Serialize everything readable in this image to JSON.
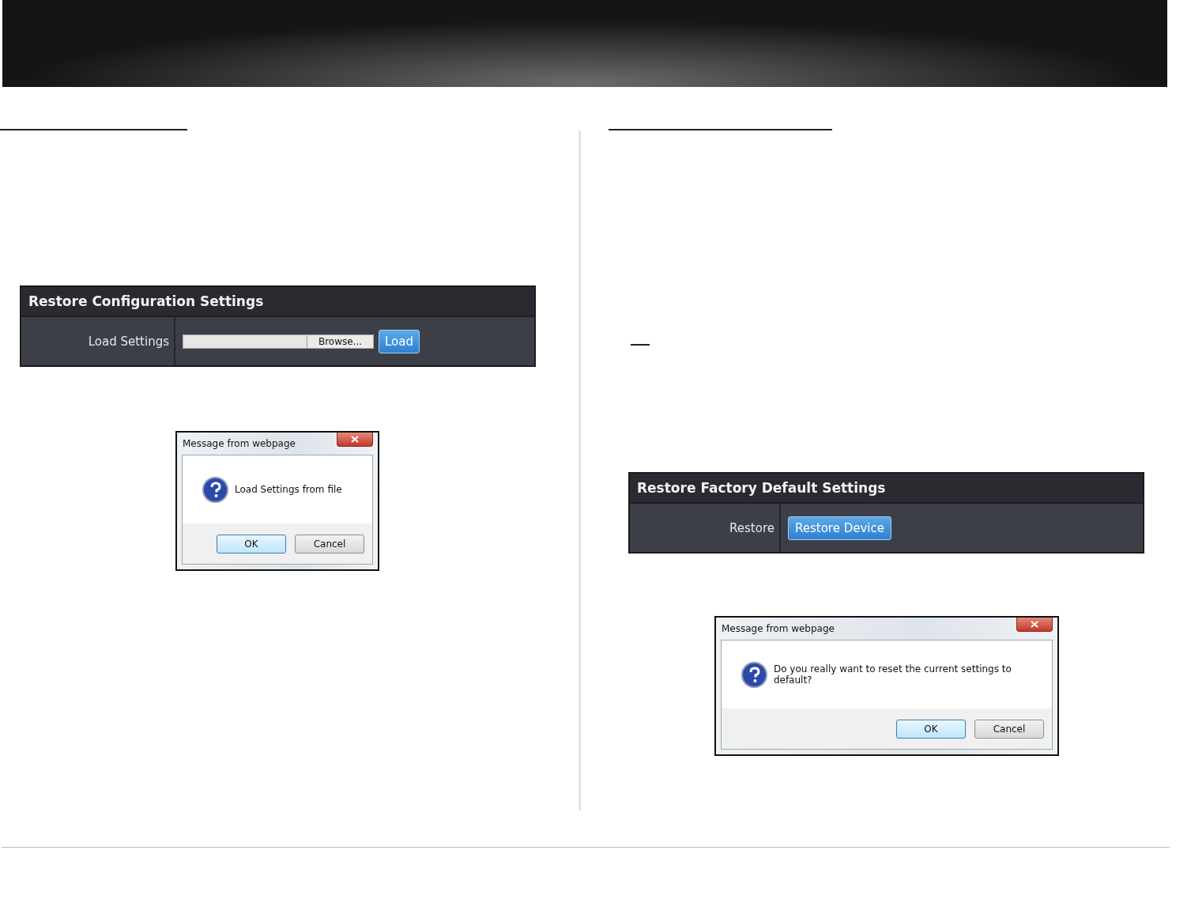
{
  "columns": [
    {
      "panel": {
        "title": "Restore Configuration Settings",
        "row_label": "Load Settings",
        "kind": "file",
        "browse_label": "Browse...",
        "button": "Load"
      },
      "dialog": {
        "title": "Message from webpage",
        "message": "Load Settings from file",
        "buttons": [
          {
            "label": "OK",
            "selected": true
          },
          {
            "label": "Cancel",
            "selected": false
          }
        ]
      }
    },
    {
      "panel": {
        "title": "Restore Factory Default Settings",
        "row_label": "Restore",
        "kind": "button",
        "button": "Restore Device"
      },
      "dialog": {
        "title": "Message from webpage",
        "message": "Do you really want to reset the current settings to default?",
        "buttons": [
          {
            "label": "OK",
            "selected": true
          },
          {
            "label": "Cancel",
            "selected": false
          }
        ]
      }
    }
  ]
}
